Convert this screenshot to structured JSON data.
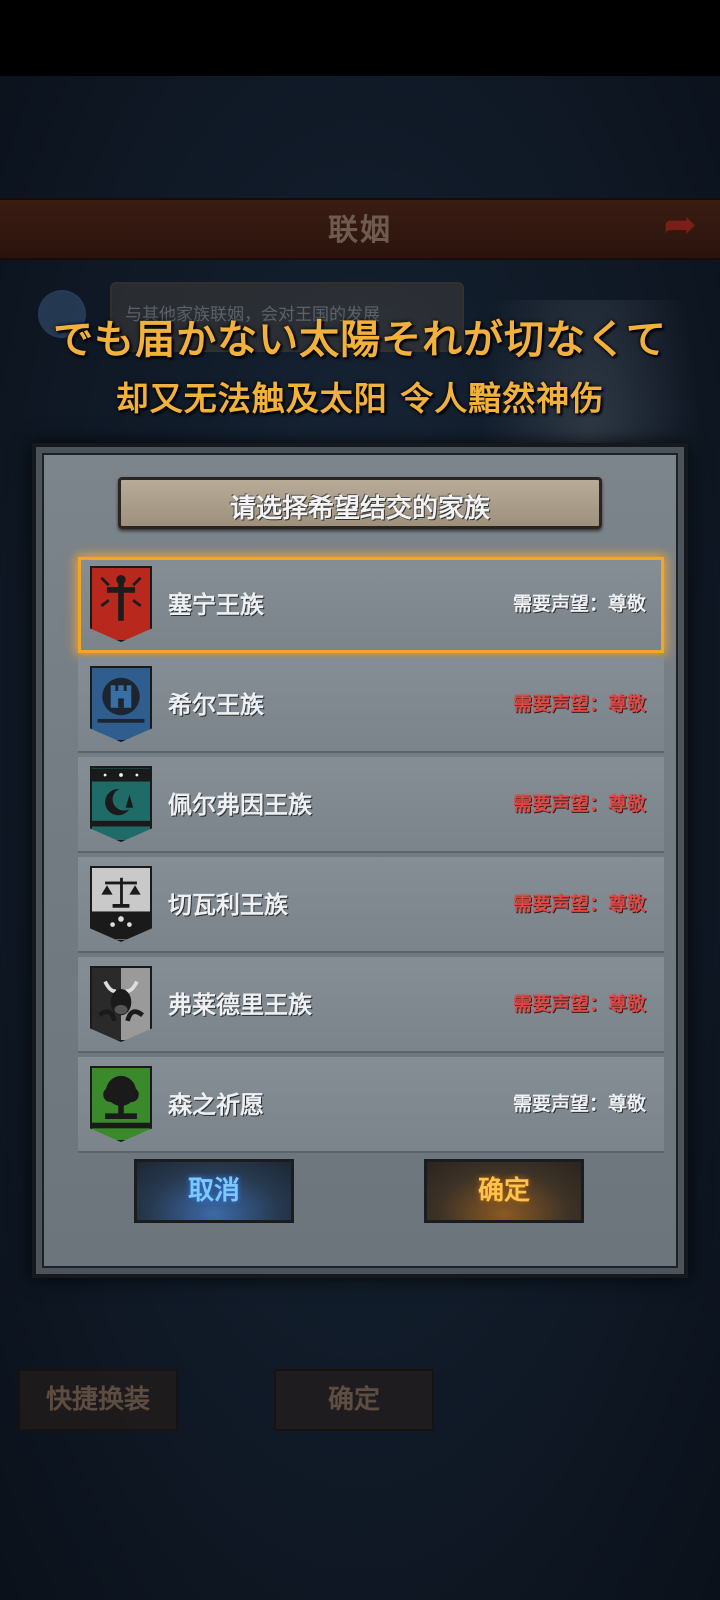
{
  "background": {
    "title": "联姻",
    "info_text": "与其他家族联姻，会对王国的发展",
    "bottom_buttons": [
      "快捷换装",
      "确定"
    ]
  },
  "subtitles": {
    "japanese": "でも届かない太陽それが切なくて",
    "chinese": "却又无法触及太阳 令人黯然神伤"
  },
  "dialog": {
    "title": "请选择希望结交的家族",
    "houses": [
      {
        "name": "塞宁王族",
        "requirement": "需要声望：尊敬",
        "met": true,
        "selected": true,
        "emblem": "red-sword-crest-icon"
      },
      {
        "name": "希尔王族",
        "requirement": "需要声望：尊敬",
        "met": false,
        "selected": false,
        "emblem": "blue-castle-crest-icon"
      },
      {
        "name": "佩尔弗因王族",
        "requirement": "需要声望：尊敬",
        "met": false,
        "selected": false,
        "emblem": "teal-moon-crest-icon"
      },
      {
        "name": "切瓦利王族",
        "requirement": "需要声望：尊敬",
        "met": false,
        "selected": false,
        "emblem": "scales-crest-icon"
      },
      {
        "name": "弗莱德里王族",
        "requirement": "需要声望：尊敬",
        "met": false,
        "selected": false,
        "emblem": "bull-crest-icon"
      },
      {
        "name": "森之祈愿",
        "requirement": "需要声望：尊敬",
        "met": true,
        "selected": false,
        "emblem": "tree-crest-icon"
      }
    ],
    "cancel_label": "取消",
    "confirm_label": "确定"
  },
  "colors": {
    "subtitle": "#f2b13a",
    "selected_outline": "#f2a628",
    "requirement_unmet": "#d94b46",
    "cancel_glow": "#7ec8ff",
    "confirm_glow": "#ffc24a"
  }
}
